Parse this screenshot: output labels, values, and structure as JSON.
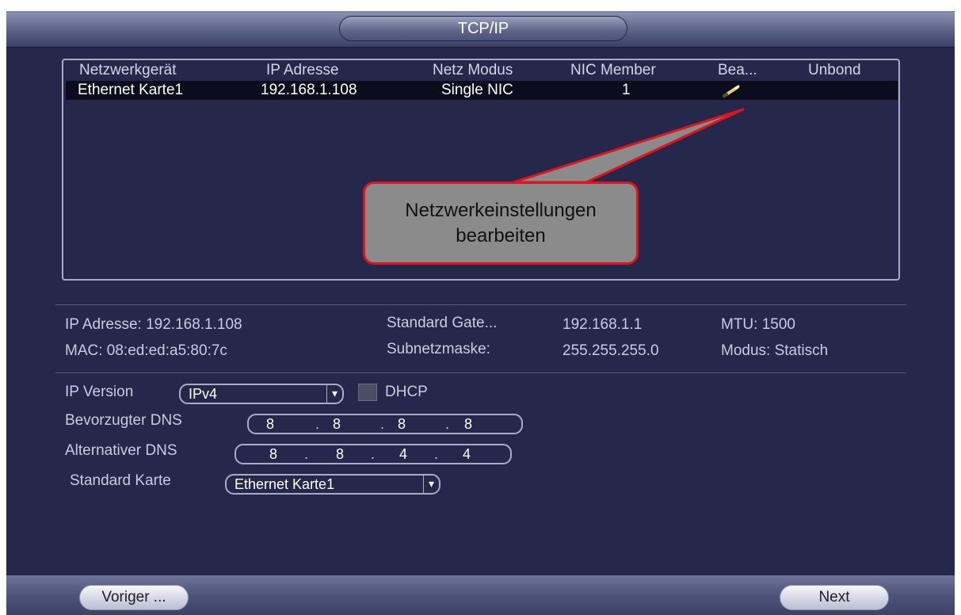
{
  "window": {
    "title": "TCP/IP"
  },
  "table": {
    "headers": [
      "Netzwerkgerät",
      "IP Adresse",
      "Netz Modus",
      "NIC Member",
      "Bea...",
      "Unbond"
    ],
    "rows": [
      {
        "device": "Ethernet Karte1",
        "ip": "192.168.1.108",
        "mode": "Single NIC",
        "member": "1",
        "edit_icon": "pencil-icon"
      }
    ]
  },
  "callout": {
    "line1": "Netzwerkeinstellungen",
    "line2": "bearbeiten",
    "border_color": "#e0141c"
  },
  "info": {
    "ip": "IP Adresse: 192.168.1.108",
    "mac": "MAC: 08:ed:ed:a5:80:7c",
    "gateway_label": "Standard Gate...",
    "gateway_value": "192.168.1.1",
    "subnet_label": "Subnetzmaske:",
    "subnet_value": "255.255.255.0",
    "mtu": "MTU: 1500",
    "modus": "Modus: Statisch"
  },
  "form": {
    "ip_version_label": "IP Version",
    "ip_version_value": "IPv4",
    "dhcp_label": "DHCP",
    "preferred_dns_label": "Bevorzugter DNS",
    "preferred_dns": [
      "8",
      "8",
      "8",
      "8"
    ],
    "alt_dns_label": "Alternativer DNS",
    "alt_dns": [
      "8",
      "8",
      "4",
      "4"
    ],
    "default_card_label": "Standard Karte",
    "default_card_value": "Ethernet Karte1",
    "dropdown_glyph": "▾",
    "ip_dot": "."
  },
  "footer": {
    "back_label": "Voriger ...",
    "next_label": "Next"
  },
  "colors": {
    "background": "#25284a",
    "accent_red": "#e0141c",
    "selected_row": "#0c0d1c"
  }
}
